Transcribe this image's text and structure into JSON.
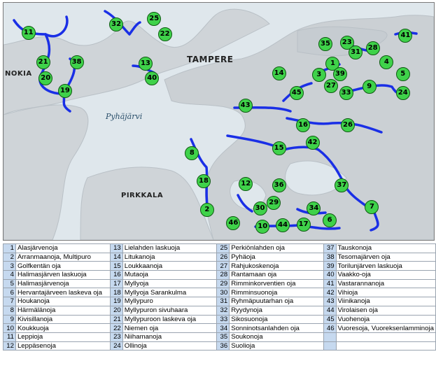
{
  "map": {
    "place_labels": {
      "tampere": "TAMPERE",
      "nokia": "NOKIA",
      "pirkkala": "PIRKKALA"
    },
    "lake_labels": {
      "pyhajarvi": "Pyhäjärvi"
    },
    "colors": {
      "water": "#dfe7ec",
      "land": "#cfd4d8",
      "stream": "#1a2fe6",
      "marker": "#3fd24a"
    }
  },
  "markers": [
    {
      "num": "1",
      "x": 0.765,
      "y": 0.258
    },
    {
      "num": "2",
      "x": 0.473,
      "y": 0.872
    },
    {
      "num": "3",
      "x": 0.733,
      "y": 0.303
    },
    {
      "num": "4",
      "x": 0.89,
      "y": 0.25
    },
    {
      "num": "5",
      "x": 0.928,
      "y": 0.3
    },
    {
      "num": "6",
      "x": 0.758,
      "y": 0.917
    },
    {
      "num": "7",
      "x": 0.856,
      "y": 0.862
    },
    {
      "num": "8",
      "x": 0.438,
      "y": 0.635
    },
    {
      "num": "9",
      "x": 0.85,
      "y": 0.353
    },
    {
      "num": "10",
      "x": 0.602,
      "y": 0.944
    },
    {
      "num": "11",
      "x": 0.058,
      "y": 0.126
    },
    {
      "num": "12",
      "x": 0.563,
      "y": 0.765
    },
    {
      "num": "13",
      "x": 0.33,
      "y": 0.258
    },
    {
      "num": "14",
      "x": 0.64,
      "y": 0.297
    },
    {
      "num": "15",
      "x": 0.64,
      "y": 0.615
    },
    {
      "num": "16",
      "x": 0.696,
      "y": 0.515
    },
    {
      "num": "17",
      "x": 0.697,
      "y": 0.935
    },
    {
      "num": "18",
      "x": 0.465,
      "y": 0.753
    },
    {
      "num": "19",
      "x": 0.143,
      "y": 0.371
    },
    {
      "num": "20",
      "x": 0.098,
      "y": 0.32
    },
    {
      "num": "21",
      "x": 0.092,
      "y": 0.25
    },
    {
      "num": "22",
      "x": 0.375,
      "y": 0.132
    },
    {
      "num": "23",
      "x": 0.798,
      "y": 0.167
    },
    {
      "num": "24",
      "x": 0.928,
      "y": 0.382
    },
    {
      "num": "25",
      "x": 0.35,
      "y": 0.067
    },
    {
      "num": "26",
      "x": 0.8,
      "y": 0.515
    },
    {
      "num": "27",
      "x": 0.761,
      "y": 0.35
    },
    {
      "num": "28",
      "x": 0.858,
      "y": 0.191
    },
    {
      "num": "29",
      "x": 0.628,
      "y": 0.844
    },
    {
      "num": "30",
      "x": 0.596,
      "y": 0.868
    },
    {
      "num": "31",
      "x": 0.818,
      "y": 0.208
    },
    {
      "num": "32",
      "x": 0.262,
      "y": 0.09
    },
    {
      "num": "33",
      "x": 0.796,
      "y": 0.382
    },
    {
      "num": "34",
      "x": 0.721,
      "y": 0.868
    },
    {
      "num": "35",
      "x": 0.748,
      "y": 0.173
    },
    {
      "num": "36",
      "x": 0.64,
      "y": 0.77
    },
    {
      "num": "37",
      "x": 0.786,
      "y": 0.771
    },
    {
      "num": "38",
      "x": 0.17,
      "y": 0.25
    },
    {
      "num": "39",
      "x": 0.782,
      "y": 0.302
    },
    {
      "num": "40",
      "x": 0.345,
      "y": 0.32
    },
    {
      "num": "41",
      "x": 0.934,
      "y": 0.138
    },
    {
      "num": "42",
      "x": 0.718,
      "y": 0.59
    },
    {
      "num": "43",
      "x": 0.562,
      "y": 0.435
    },
    {
      "num": "44",
      "x": 0.649,
      "y": 0.937
    },
    {
      "num": "45",
      "x": 0.681,
      "y": 0.38
    },
    {
      "num": "46",
      "x": 0.534,
      "y": 0.93
    }
  ],
  "legend": [
    {
      "num": "1",
      "name": "Alasjärvenoja"
    },
    {
      "num": "2",
      "name": "Arranmaanoja, Multipuro"
    },
    {
      "num": "3",
      "name": "Golfkentän oja"
    },
    {
      "num": "4",
      "name": "Halimasjärven laskuoja"
    },
    {
      "num": "5",
      "name": "Halimasjärvenoja"
    },
    {
      "num": "6",
      "name": "Hervantajärveen laskeva oja"
    },
    {
      "num": "7",
      "name": "Houkanoja"
    },
    {
      "num": "8",
      "name": "Härmälänoja"
    },
    {
      "num": "9",
      "name": "Kivisillanoja"
    },
    {
      "num": "10",
      "name": "Koukkuoja"
    },
    {
      "num": "11",
      "name": "Leppioja"
    },
    {
      "num": "12",
      "name": "Leppäsenoja"
    },
    {
      "num": "13",
      "name": "Lielahden laskuoja"
    },
    {
      "num": "14",
      "name": "Litukanoja"
    },
    {
      "num": "15",
      "name": "Loukkaanoja"
    },
    {
      "num": "16",
      "name": "Mutaoja"
    },
    {
      "num": "17",
      "name": "Myllyoja"
    },
    {
      "num": "18",
      "name": "Myllyoja Sarankulma"
    },
    {
      "num": "19",
      "name": "Myllypuro"
    },
    {
      "num": "20",
      "name": "Myllypuron sivuhaara"
    },
    {
      "num": "21",
      "name": "Myllypuroon laskeva oja"
    },
    {
      "num": "22",
      "name": "Niemen oja"
    },
    {
      "num": "23",
      "name": "Niihamanoja"
    },
    {
      "num": "24",
      "name": "Ollinoja"
    },
    {
      "num": "25",
      "name": "Perkiönlahden oja"
    },
    {
      "num": "26",
      "name": "Pyhäoja"
    },
    {
      "num": "27",
      "name": "Rahjukoskenoja"
    },
    {
      "num": "28",
      "name": "Rantamaan oja"
    },
    {
      "num": "29",
      "name": "Rimminkorventien oja"
    },
    {
      "num": "30",
      "name": "Rimminsuonoja"
    },
    {
      "num": "31",
      "name": "Ryhmäpuutarhan oja"
    },
    {
      "num": "32",
      "name": "Ryydynoja"
    },
    {
      "num": "33",
      "name": "Sikosuonoja"
    },
    {
      "num": "34",
      "name": "Sonninotsanlahden oja"
    },
    {
      "num": "35",
      "name": "Soukonoja"
    },
    {
      "num": "36",
      "name": "Suolioja"
    },
    {
      "num": "37",
      "name": "Tauskonoja"
    },
    {
      "num": "38",
      "name": "Tesomajärven oja"
    },
    {
      "num": "39",
      "name": "Torilunjärven laskuoja"
    },
    {
      "num": "40",
      "name": "Vaakko-oja"
    },
    {
      "num": "41",
      "name": "Vastarannanoja"
    },
    {
      "num": "42",
      "name": "Vihioja"
    },
    {
      "num": "43",
      "name": "Viinikanoja"
    },
    {
      "num": "44",
      "name": "Virolaisen oja"
    },
    {
      "num": "45",
      "name": "Vuohenoja"
    },
    {
      "num": "46",
      "name": "Vuoresoja, Vuoreksenlamminoja"
    },
    {
      "num": "",
      "name": ""
    },
    {
      "num": "",
      "name": ""
    }
  ]
}
